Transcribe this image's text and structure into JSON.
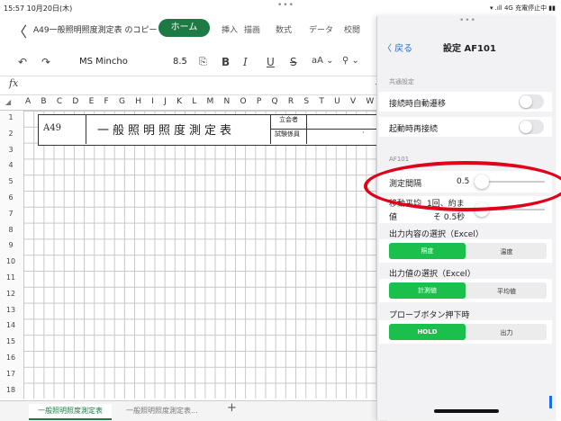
{
  "status_bar": {
    "time": "15:57  10月20日(木)",
    "dots": "•••",
    "right": "▾ .ıll 4G 充電停止中 ▮▮"
  },
  "title_bar": {
    "back": "〈",
    "doc_title": "A49一般照明照度測定表 のコピー ⌄"
  },
  "ribbon_tabs": [
    "ホーム",
    "挿入",
    "描画",
    "数式",
    "データ",
    "校閲"
  ],
  "toolbar": {
    "undo": "↶",
    "redo": "↷",
    "font_name": "MS Mincho",
    "font_size": "8.5",
    "bold": "B",
    "italic": "I",
    "underline": "U",
    "strike": "S",
    "text_color": "aA ⌄",
    "fill": "⚲ ⌄"
  },
  "formula_bar": {
    "fx": "fx"
  },
  "columns": "A B C D E F G H I J K L M N O P Q R S T U V W X Y Z AAABAC",
  "rows": [
    "1",
    "2",
    "3",
    "4",
    "5",
    "6",
    "7",
    "8",
    "9",
    "10",
    "11",
    "12",
    "13",
    "14",
    "15",
    "16",
    "17",
    "18"
  ],
  "sheet": {
    "cell_a1": "A49",
    "title": "一般照明照度測定表",
    "label_attendee": "立会者",
    "label_tester": "試験係員",
    "mark": "·"
  },
  "sheet_tabs": {
    "active": "一般照明照度測定表",
    "other": "一般照明照度測定表...",
    "add": "+"
  },
  "panel": {
    "dots": "•••",
    "back_label": "〈 戻る",
    "title": "設定 AF101",
    "section_common": "共通設定",
    "auto_transition": "接続時自動遷移",
    "reconnect": "起動時再接続",
    "section_af101": "AF101",
    "interval_label": "測定間隔",
    "interval_value": "0.5",
    "moving_avg_label1": "移動平均",
    "moving_avg_note1": "1回、約ま",
    "moving_avg_label2": "値",
    "moving_avg_note2": "そ 0.5秒",
    "output_content_label": "出力内容の選択（Excel）",
    "output_content_options": [
      "照度",
      "温度"
    ],
    "output_value_label": "出力値の選択（Excel）",
    "output_value_options": [
      "計測値",
      "平均値"
    ],
    "probe_label": "プローブボタン押下時",
    "probe_options": [
      "HOLD",
      "出力"
    ]
  },
  "colors": {
    "excel_green": "#1d7a45",
    "toggle_on_green": "#1ac04b",
    "annotation_red": "#e0001a",
    "link_blue": "#1a6fe8"
  }
}
